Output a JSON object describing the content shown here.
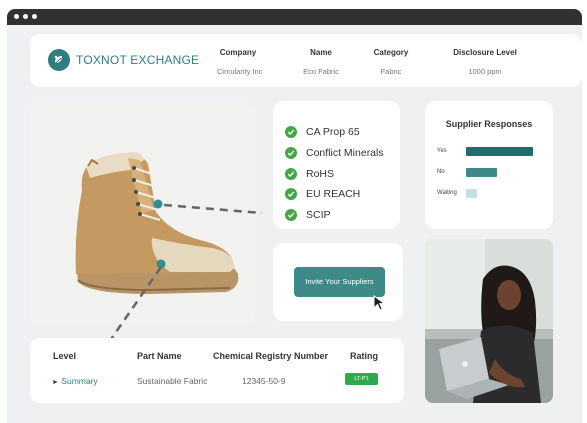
{
  "brand": {
    "name": "TOXNOT EXCHANGE",
    "color": "#2f7d7d"
  },
  "header": {
    "columns": [
      {
        "label": "Company",
        "value": "Circularity Inc"
      },
      {
        "label": "Name",
        "value": "Eco Fabric"
      },
      {
        "label": "Category",
        "value": "Fabric"
      },
      {
        "label": "Disclosure Level",
        "value": "1000 ppm"
      }
    ]
  },
  "compliance": {
    "items": [
      {
        "label": "CA Prop 65",
        "icon": "check-circle-icon"
      },
      {
        "label": "Conflict Minerals",
        "icon": "check-circle-icon"
      },
      {
        "label": "RoHS",
        "icon": "check-circle-icon"
      },
      {
        "label": "EU REACH",
        "icon": "check-circle-icon"
      },
      {
        "label": "SCIP",
        "icon": "check-circle-icon"
      }
    ],
    "check_color": "#44a647"
  },
  "supplier_responses": {
    "title": "Supplier Responses",
    "rows": [
      {
        "label": "Yes",
        "fraction": 1.0,
        "color": "#1f6e6e"
      },
      {
        "label": "No",
        "fraction": 0.47,
        "color": "#3d8a88"
      },
      {
        "label": "Waiting",
        "fraction": 0.17,
        "color": "#c7dede"
      }
    ]
  },
  "invite": {
    "button_label": "Invite Your Suppliers",
    "color": "#3d8a88"
  },
  "table": {
    "headers": [
      "Level",
      "Part Name",
      "Chemical Registry Number",
      "Rating"
    ],
    "rows": [
      {
        "level": "Summary",
        "part_name": "Sustainable Fabric",
        "registry_number": "12345-50-9",
        "rating": "LT-P1"
      }
    ],
    "rating_color": "#2daa4c"
  }
}
